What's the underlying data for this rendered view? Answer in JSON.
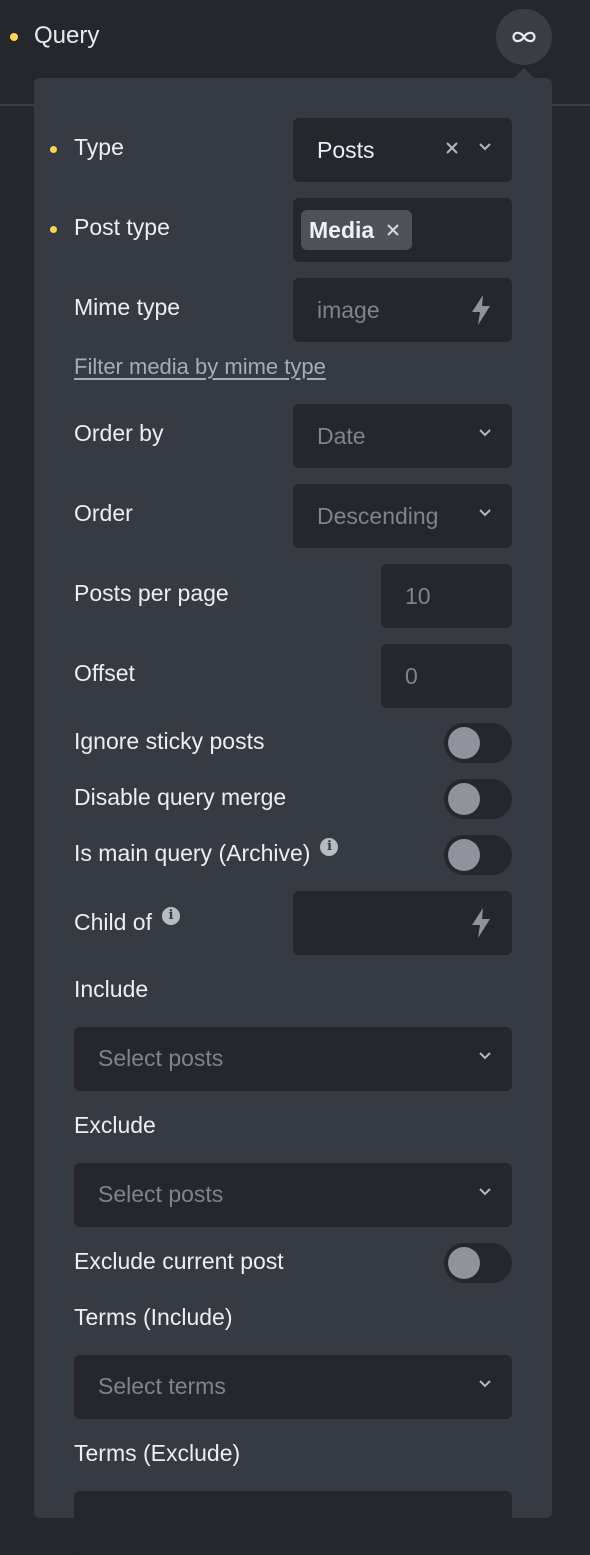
{
  "header": {
    "title": "Query",
    "toggle_icon": "infinity-icon"
  },
  "fields": {
    "type": {
      "label": "Type",
      "value": "Posts"
    },
    "post_type": {
      "label": "Post type",
      "tag": "Media"
    },
    "mime_type": {
      "label": "Mime type",
      "placeholder": "image"
    },
    "filter_link": "Filter media by mime type",
    "order_by": {
      "label": "Order by",
      "placeholder": "Date"
    },
    "order": {
      "label": "Order",
      "placeholder": "Descending"
    },
    "posts_per_page": {
      "label": "Posts per page",
      "placeholder": "10"
    },
    "offset": {
      "label": "Offset",
      "placeholder": "0"
    },
    "ignore_sticky": {
      "label": "Ignore sticky posts",
      "on": false
    },
    "disable_merge": {
      "label": "Disable query merge",
      "on": false
    },
    "is_main_query": {
      "label": "Is main query (Archive)",
      "on": false
    },
    "child_of": {
      "label": "Child of"
    },
    "include": {
      "label": "Include",
      "placeholder": "Select posts"
    },
    "exclude": {
      "label": "Exclude",
      "placeholder": "Select posts"
    },
    "exclude_current": {
      "label": "Exclude current post",
      "on": false
    },
    "terms_include": {
      "label": "Terms (Include)",
      "placeholder": "Select terms"
    },
    "terms_exclude": {
      "label": "Terms (Exclude)"
    }
  },
  "colors": {
    "background": "#25272c",
    "panel": "#363a42",
    "accent_dot": "#ffd64f",
    "input": "#25272c"
  }
}
